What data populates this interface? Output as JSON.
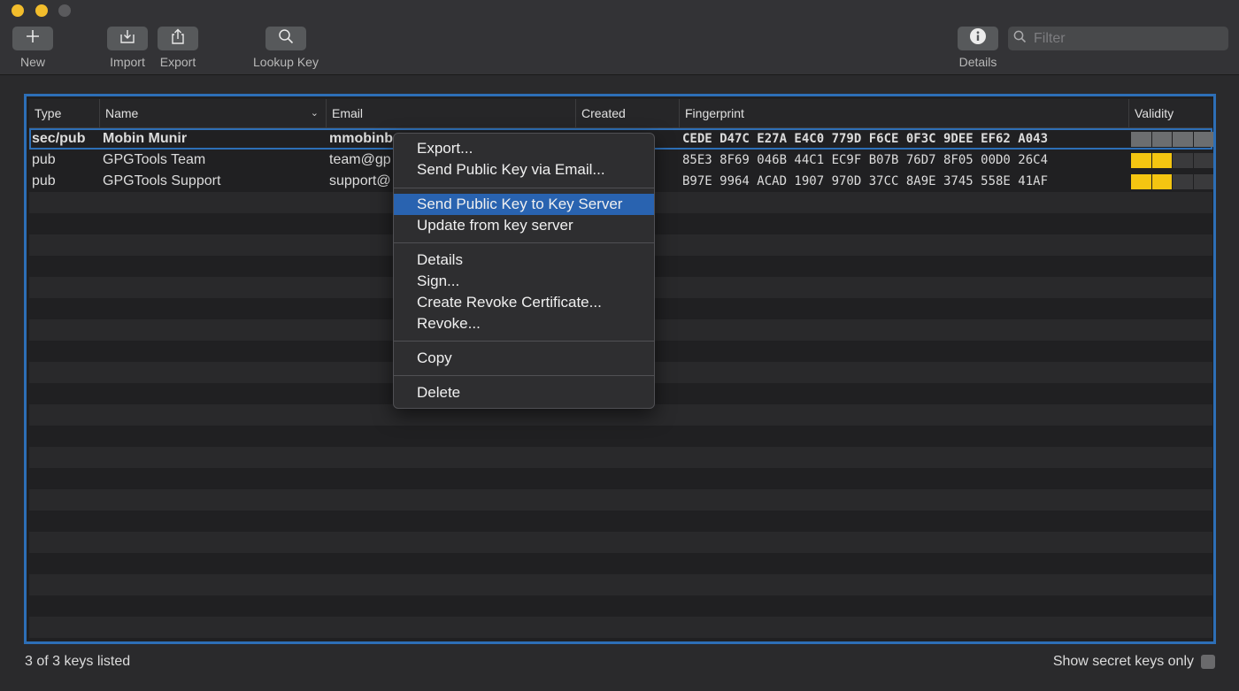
{
  "toolbar": {
    "new_label": "New",
    "import_label": "Import",
    "export_label": "Export",
    "lookup_label": "Lookup Key",
    "details_label": "Details",
    "filter_placeholder": "Filter"
  },
  "table": {
    "columns": [
      "Type",
      "Name",
      "Email",
      "Created",
      "Fingerprint",
      "Validity"
    ],
    "rows": [
      {
        "type": "sec/pub",
        "name": "Mobin Munir",
        "email": "mmobinb...@...",
        "created": "...",
        "fingerprint": "CEDE D47C E27A E4C0 779D  F6CE 0F3C 9DEE EF62 A043",
        "validity_filled": 0,
        "selected": true
      },
      {
        "type": "pub",
        "name": "GPGTools Team",
        "email": "team@gp",
        "created": "",
        "fingerprint": "85E3 8F69 046B 44C1 EC9F  B07B 76D7 8F05 00D0 26C4",
        "validity_filled": 2,
        "selected": false
      },
      {
        "type": "pub",
        "name": "GPGTools Support",
        "email": "support@",
        "created": "",
        "fingerprint": "B97E 9964 ACAD 1907 970D  37CC 8A9E 3745 558E 41AF",
        "validity_filled": 2,
        "selected": false
      }
    ]
  },
  "context_menu": {
    "items": [
      "Export...",
      "Send Public Key via Email...",
      "Send Public Key to Key Server",
      "Update from key server",
      "Details",
      "Sign...",
      "Create Revoke Certificate...",
      "Revoke...",
      "Copy",
      "Delete"
    ],
    "highlighted": "Send Public Key to Key Server"
  },
  "footer": {
    "status": "3 of 3 keys listed",
    "secret_only_label": "Show secret keys only"
  },
  "colors": {
    "accent": "#2963b0",
    "validity_yellow": "#f4c511",
    "selection_border": "#2d6fb7"
  },
  "icons": {
    "new": "plus-icon",
    "import": "import-tray-icon",
    "export": "share-icon",
    "lookup": "magnifier-icon",
    "details": "info-icon",
    "filter": "search-icon",
    "sort": "chevron-down-icon"
  }
}
